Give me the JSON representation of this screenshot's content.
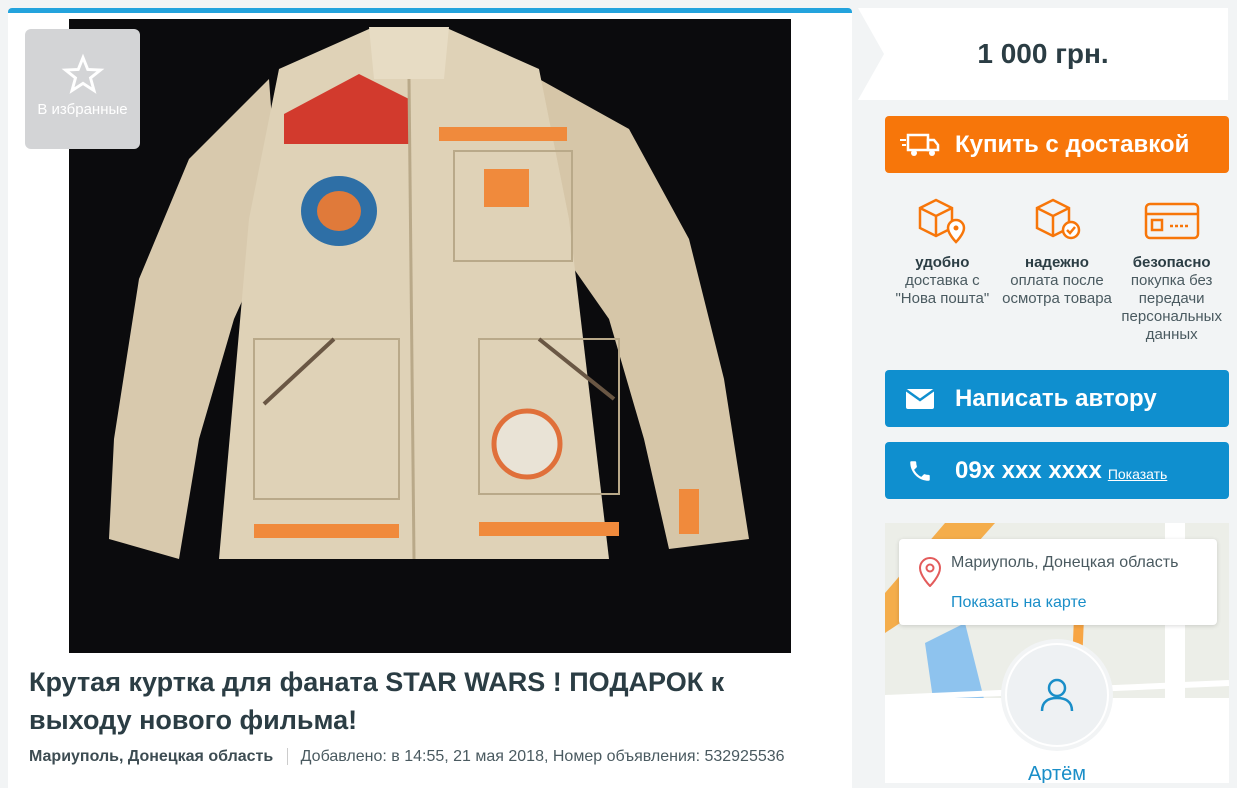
{
  "favorite": {
    "label": "В избранные",
    "icon": "star-icon"
  },
  "listing": {
    "title": "Крутая куртка для фаната STAR WARS ! ПОДАРОК к выходу нового фильма!",
    "location": "Мариуполь, Донецкая область",
    "added": "Добавлено: в 14:55, 21 мая 2018, Номер объявления: 532925536"
  },
  "price": "1 000 грн.",
  "buy_button": {
    "label": "Купить с доставкой",
    "icon": "truck-icon"
  },
  "features": [
    {
      "title": "удобно",
      "text": "доставка с \"Нова пошта\"",
      "icon": "box-location-icon"
    },
    {
      "title": "надежно",
      "text": "оплата после осмотра товара",
      "icon": "box-check-icon"
    },
    {
      "title": "безопасно",
      "text": "покупка без передачи персональных данных",
      "icon": "card-icon"
    }
  ],
  "message_button": {
    "label": "Написать автору",
    "icon": "envelope-icon"
  },
  "phone_button": {
    "number": "09x xxx xxxx",
    "show_label": "Показать",
    "icon": "phone-icon"
  },
  "map": {
    "address": "Мариуполь, Донецкая область",
    "link": "Показать на карте",
    "user_partial": "Артём"
  },
  "colors": {
    "accent_blue": "#0f8fcf",
    "orange": "#f7760a",
    "top_bar": "#23a3dd"
  }
}
